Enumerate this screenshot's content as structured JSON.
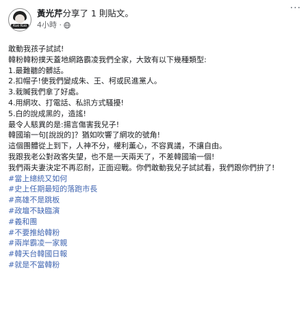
{
  "header": {
    "author": "黃光芹",
    "action": "分享了 1 則貼文。",
    "time": "4小時 ·",
    "more_label": "···",
    "avatar_badge": "Kuo Kuo"
  },
  "body": {
    "lines": [
      "敢動我孩子試試!",
      "韓粉韓粉撲天蓋地網路霸凌我們全家，大致有以下幾種類型:",
      "1.最難聽的髒話。",
      "2.扣帽子!使我們變成朱、王、柯或民進黨人。",
      "3.栽贓我們拿了好處。",
      "4.用網攻、打電話、私訊方式騷擾!",
      "5.白的說成黑的，造謠!",
      "最令人駭異的是:揚言傷害我兒子!",
      "韓國瑜一句[說說的]？猶如吹響了網攻的號角!",
      "這個團體從上到下，人神不分，權利薰心，不容異議，不讓自由。",
      "我跟我老公對政客失望，也不是一天兩天了，不差韓國瑜一個!",
      "我們兩夫妻決定不再忍耐，正面迎戰。你們敢動我兒子試試看，我們跟你們拚了!"
    ],
    "hashtags": [
      "#當上總統又如何",
      "#史上任期最短的落跑市長",
      "#高雄不是跳板",
      "#政壇不缺臨演",
      "#義和團",
      "#不要推給韓粉",
      "#兩岸霸凌一家親",
      "#韓天台韓國日報",
      "#就是不當韓粉"
    ]
  },
  "colors": {
    "text": "#1c1e21",
    "muted": "#65676b",
    "hashtag": "#4267b2"
  }
}
